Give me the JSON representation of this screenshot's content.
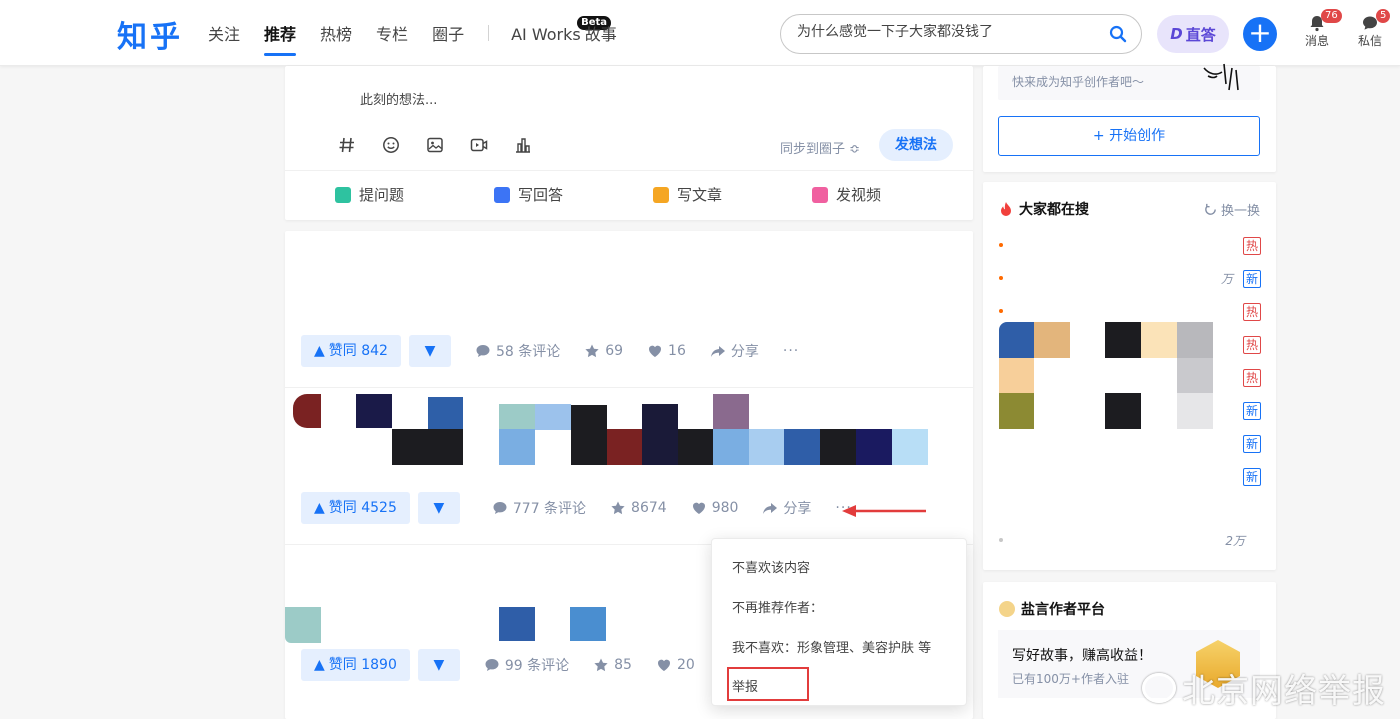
{
  "header": {
    "logo": "知乎",
    "nav": [
      "关注",
      "推荐",
      "热榜",
      "专栏",
      "圈子"
    ],
    "active_nav": "推荐",
    "ai_works": "AI Works",
    "beta": "Beta",
    "story": "故事",
    "search_placeholder": "为什么感觉一下子大家都没钱了",
    "zhida": "直答",
    "messages_label": "消息",
    "messages_count": "76",
    "dm_label": "私信",
    "dm_count": "5"
  },
  "composer": {
    "prompt": "此刻的想法...",
    "sync": "同步到圈子 ≎",
    "post": "发想法",
    "actions": [
      {
        "label": "提问题",
        "color": "#2ec2a0"
      },
      {
        "label": "写回答",
        "color": "#3c74f5"
      },
      {
        "label": "写文章",
        "color": "#f5a623"
      },
      {
        "label": "发视频",
        "color": "#f060a0"
      }
    ]
  },
  "feed": {
    "items": [
      {
        "votes": "赞同 842",
        "comments": "58 条评论",
        "favorites": "69",
        "likes": "16",
        "share": "分享"
      },
      {
        "votes": "赞同 4525",
        "comments": "777 条评论",
        "favorites": "8674",
        "likes": "980",
        "share": "分享"
      },
      {
        "votes": "赞同 1890",
        "comments": "99 条评论",
        "favorites": "85",
        "likes": "20"
      }
    ],
    "more": "···"
  },
  "popup": {
    "items": [
      "不喜欢该内容",
      "不再推荐作者：",
      "我不喜欢：形象管理、美容护肤 等",
      "举报"
    ]
  },
  "sidebar": {
    "creator_tip": "快来成为知乎创作者吧～",
    "start_button": "+ 开始创作",
    "hot_title": "大家都在搜",
    "refresh": "换一换",
    "hot_tags": [
      "热",
      "新",
      "热",
      "热",
      "热",
      "新",
      "新",
      "新"
    ],
    "row2_text": "万",
    "last_row_text": "2万",
    "platform_title": "盐言作者平台",
    "earn_title": "写好故事，赚高收益！",
    "earn_sub": "已有100万+作者入驻"
  },
  "watermark": "北京网络举报"
}
